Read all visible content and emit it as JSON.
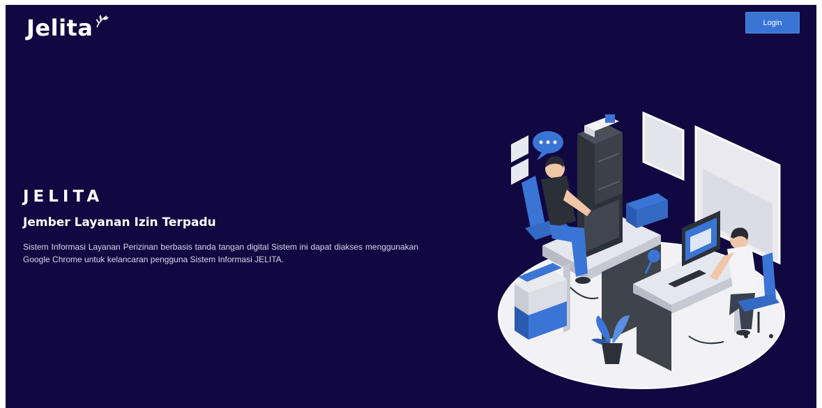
{
  "header": {
    "logo_text": "Jelita",
    "login_label": "Login"
  },
  "hero": {
    "title": "JELITA",
    "subtitle": "Jember Layanan Izin Terpadu",
    "description": "Sistem Informasi Layanan Perizinan berbasis tanda tangan digital Sistem ini dapat diakses menggunakan Google Chrome untuk kelancaran pengguna Sistem Informasi JELITA."
  },
  "colors": {
    "background": "#110841",
    "accent": "#3a75d6"
  },
  "illustration": {
    "icon": "office-workers-illustration"
  }
}
